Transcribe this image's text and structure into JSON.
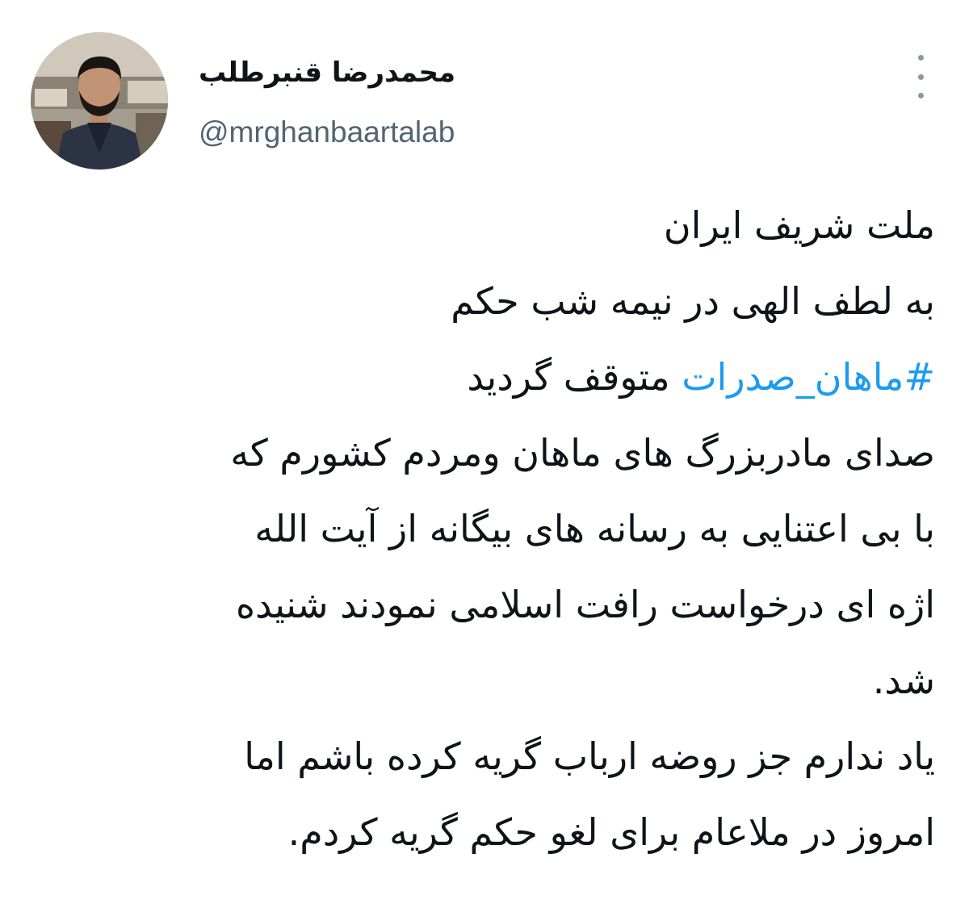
{
  "author": {
    "display_name": "محمدرضا قنبرطلب",
    "handle": "@mrghanbaartalab"
  },
  "icons": {
    "more": "more-vertical-icon",
    "avatar": "profile-photo"
  },
  "colors": {
    "text": "#0f1419",
    "handle": "#536471",
    "hashtag": "#1d9bf0",
    "more_icon": "#8a98a5"
  },
  "tweet": {
    "line1": "ملت شریف ایران",
    "line2": "به لطف الهی در نیمه شب حکم",
    "line3_hashtag": "#ماهان_صدرات",
    "line3_rest": "متوقف گردید",
    "line4": "صدای مادربزرگ های ماهان ومردم کشورم که",
    "line5": "با بی اعتنایی به رسانه های بیگانه از آیت الله",
    "line6": "اژه ای درخواست رافت اسلامی نمودند شنیده",
    "line7": "شد.",
    "line8": "یاد ندارم جز روضه ارباب گریه کرده باشم اما",
    "line9": "امروز در ملاعام برای لغو حکم گریه کردم."
  }
}
